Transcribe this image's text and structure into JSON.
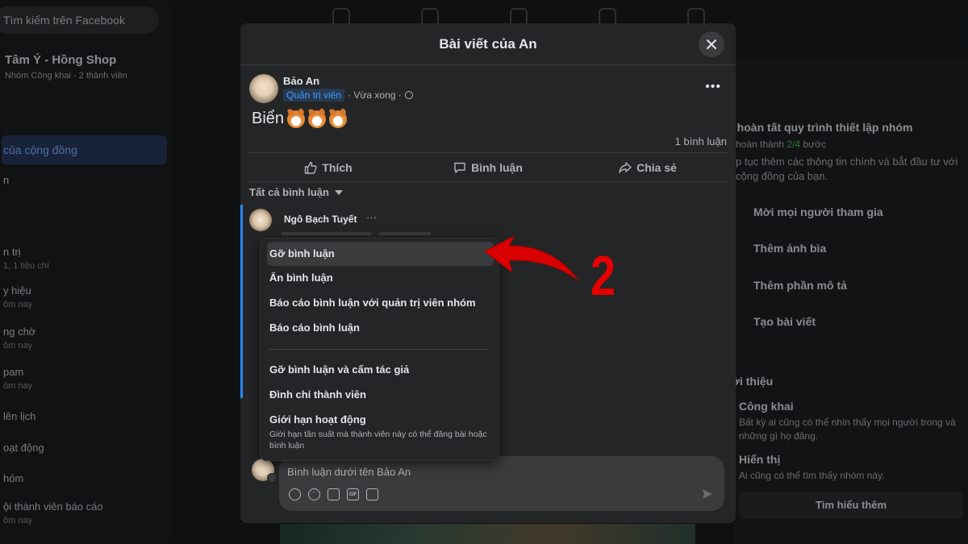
{
  "background": {
    "search_placeholder": "Tìm kiếm trên Facebook",
    "group_name": "Tâm Ý - Hồng Shop",
    "group_meta": "Nhóm Công khai · 2 thành viên",
    "selected_nav": "của cộng đồng",
    "nav_items": [
      {
        "label": "n",
        "sub": ""
      },
      {
        "label": "n trị",
        "sub": "1, 1 tiêu chí"
      },
      {
        "label": "y hiệu",
        "sub": "ôm nay"
      },
      {
        "label": "ng chờ",
        "sub": "ôm nay"
      },
      {
        "label": "pam",
        "sub": "ôm nay"
      },
      {
        "label": "lên lịch",
        "sub": ""
      },
      {
        "label": "oạt động",
        "sub": ""
      },
      {
        "label": "hóm",
        "sub": ""
      },
      {
        "label": "ội thành viên báo cáo",
        "sub": "ôm nay"
      }
    ],
    "setup_title": "y hoàn tất quy trình thiết lập nhóm",
    "setup_progress_prefix": "hoàn thành",
    "setup_progress_value": "2/4",
    "setup_progress_suffix": "bước",
    "setup_desc": "p tục thêm các thông tin chính và bắt đầu tư với cộng đồng của bạn.",
    "setup_steps": [
      "Mời mọi người tham gia",
      "Thêm ảnh bìa",
      "Thêm phần mô tả",
      "Tạo bài viết"
    ],
    "about_title": "ới thiệu",
    "about_public_title": "Công khai",
    "about_public_desc": "Bất kỳ ai cũng có thể nhìn thấy mọi người trong và những gì họ đăng.",
    "about_visible_title": "Hiển thị",
    "about_visible_desc": "Ai cũng có thể tìm thấy nhóm này.",
    "learn_more": "Tìm hiểu thêm"
  },
  "modal": {
    "title": "Bài viết của An",
    "post": {
      "author": "Bảo An",
      "role_badge": "Quản trị viên",
      "time": "· Vừa xong ·",
      "text": "Biển",
      "emoji_count": 3,
      "comment_count": "1 bình luận"
    },
    "actions": {
      "like": "Thích",
      "comment": "Bình luận",
      "share": "Chia sẻ"
    },
    "comments_filter": "Tất cả bình luận",
    "comment": {
      "author": "Ngô Bạch Tuyết",
      "more": "···"
    },
    "composer": {
      "placeholder": "Bình luận dưới tên Bảo An",
      "tools": [
        "avatar-sticker-icon",
        "emoji-icon",
        "camera-icon",
        "gif-icon",
        "sticker-icon"
      ]
    }
  },
  "menu": {
    "items": [
      "Gỡ bình luận",
      "Ẩn bình luận",
      "Báo cáo bình luận với quản trị viên nhóm",
      "Báo cáo bình luận",
      "Gỡ bình luận và cấm tác giả",
      "Đình chỉ thành viên",
      "Giới hạn hoạt động"
    ],
    "limit_desc": "Giới hạn tần suất mà thành viên này có thể đăng bài hoặc bình luận"
  },
  "annotation": {
    "step_number": "2",
    "color": "#e60000"
  }
}
